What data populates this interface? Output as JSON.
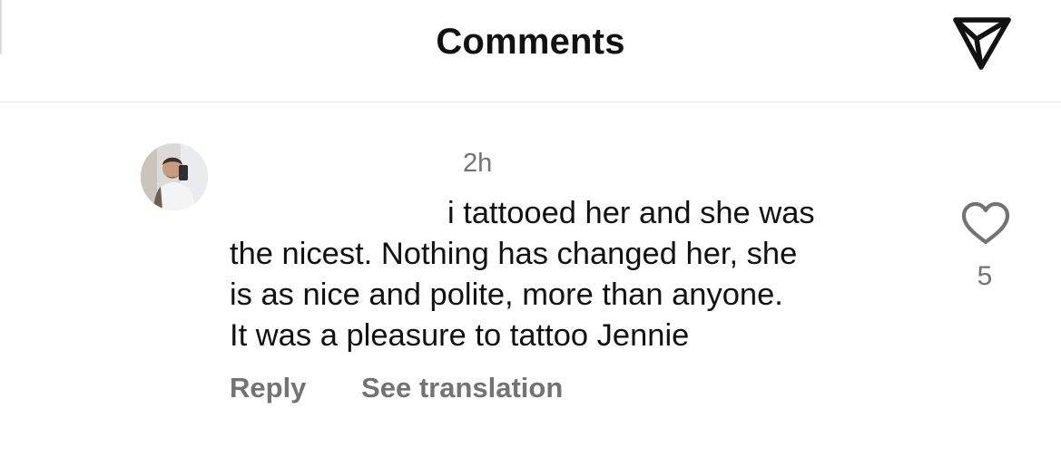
{
  "header": {
    "title": "Comments",
    "share_icon": "send-paper-plane-icon"
  },
  "comment": {
    "avatar_icon": "user-avatar",
    "timestamp": "2h",
    "text_lines": [
      "i tattooed her and she was",
      "the nicest. Nothing has changed her, she",
      "is as nice and polite, more than anyone.",
      "It was a pleasure to tattoo Jennie"
    ],
    "actions": {
      "reply": "Reply",
      "see_translation": "See translation"
    },
    "like_icon": "heart-icon",
    "like_count": "5"
  },
  "colors": {
    "text": "#111111",
    "secondary_text": "#737373",
    "divider": "#e6e6ea",
    "background": "#ffffff"
  }
}
